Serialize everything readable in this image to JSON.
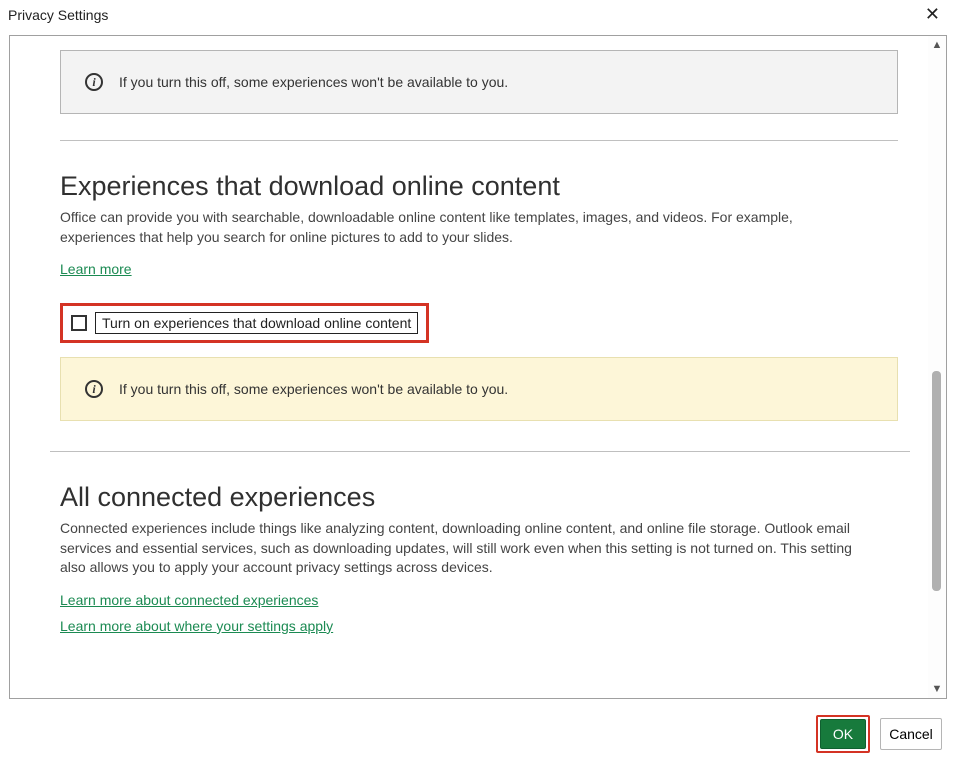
{
  "dialog": {
    "title": "Privacy Settings"
  },
  "info1": {
    "text": "If you turn this off, some experiences won't be available to you."
  },
  "section_download": {
    "title": "Experiences that download online content",
    "desc": "Office can provide you with searchable, downloadable online content like templates, images, and videos. For example, experiences that help you search for online pictures to add to your slides.",
    "learn_more": "Learn more",
    "checkbox_label": "Turn on experiences that download online content",
    "checkbox_checked": false,
    "info_text": "If you turn this off, some experiences won't be available to you."
  },
  "section_all": {
    "title": "All connected experiences",
    "desc": "Connected experiences include things like analyzing content, downloading online content, and online file storage. Outlook email services and essential services, such as downloading updates, will still work even when this setting is not turned on. This setting also allows you to apply your account privacy settings across devices.",
    "link1": "Learn more about connected experiences",
    "link2": "Learn more about where your settings apply"
  },
  "footer": {
    "ok": "OK",
    "cancel": "Cancel"
  }
}
